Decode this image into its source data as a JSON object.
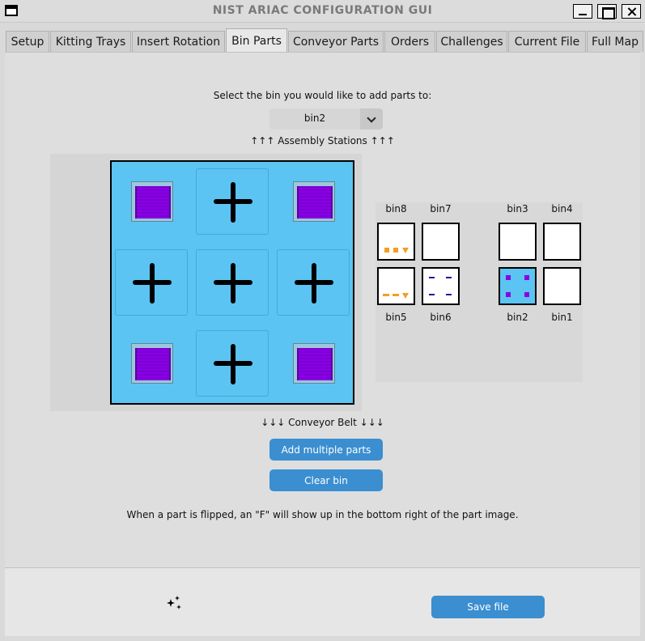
{
  "window": {
    "title": "NIST ARIAC CONFIGURATION GUI"
  },
  "tabs": [
    {
      "label": "Setup"
    },
    {
      "label": "Kitting Trays"
    },
    {
      "label": "Insert Rotation"
    },
    {
      "label": "Bin Parts",
      "active": true
    },
    {
      "label": "Conveyor Parts"
    },
    {
      "label": "Orders"
    },
    {
      "label": "Challenges"
    },
    {
      "label": "Current File"
    },
    {
      "label": "Full Map"
    }
  ],
  "bin_parts": {
    "prompt": "Select the bin you would like to add parts to:",
    "selected_bin": "bin2",
    "top_label": "↑↑↑ Assembly Stations ↑↑↑",
    "bottom_label": "↓↓↓ Conveyor Belt ↓↓↓",
    "slots": [
      "regulator",
      "empty",
      "regulator",
      "empty",
      "empty",
      "empty",
      "regulator",
      "empty",
      "regulator"
    ],
    "add_multiple_label": "Add multiple parts",
    "clear_label": "Clear bin",
    "flip_note": "When a part is flipped, an \"F\" will show up in the bottom right of the part image.",
    "bin_map": {
      "top_row": [
        "bin8",
        "bin7",
        "bin3",
        "bin4"
      ],
      "bottom_row": [
        "bin5",
        "bin6",
        "bin2",
        "bin1"
      ],
      "highlighted": "bin2"
    }
  },
  "footer": {
    "theme_icon": "moon-stars-icon",
    "save_label": "Save file"
  },
  "colors": {
    "bin_blue": "#5bc4f2",
    "button_blue": "#3b8ed0",
    "part_purple": "#8a00e6",
    "part_orange": "#f0a020",
    "part_navy": "#1a1aa0"
  }
}
